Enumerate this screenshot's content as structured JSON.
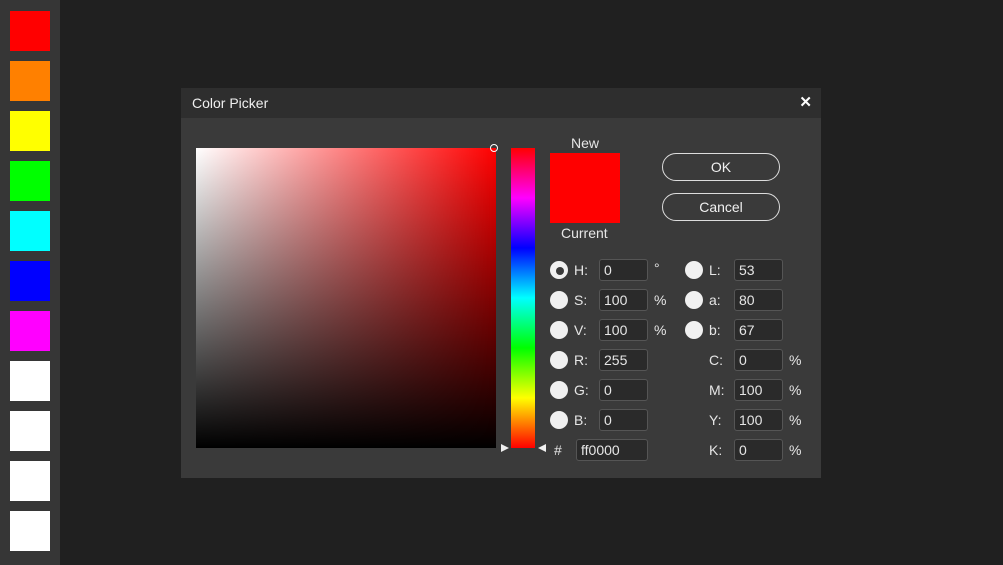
{
  "swatches": [
    {
      "name": "red",
      "color": "#ff0000"
    },
    {
      "name": "orange",
      "color": "#ff8000"
    },
    {
      "name": "yellow",
      "color": "#ffff00"
    },
    {
      "name": "green",
      "color": "#00ff00"
    },
    {
      "name": "cyan",
      "color": "#00ffff"
    },
    {
      "name": "blue",
      "color": "#0000ff"
    },
    {
      "name": "magenta",
      "color": "#ff00ff"
    },
    {
      "name": "white",
      "color": "#ffffff"
    },
    {
      "name": "white",
      "color": "#ffffff"
    },
    {
      "name": "white",
      "color": "#ffffff"
    },
    {
      "name": "white",
      "color": "#ffffff"
    }
  ],
  "dialog": {
    "title": "Color Picker",
    "close_icon": "close-icon",
    "preview": {
      "new_label": "New",
      "current_label": "Current",
      "new_color": "#ff0000",
      "current_color": "#ff0000"
    },
    "buttons": {
      "ok": "OK",
      "cancel": "Cancel"
    },
    "selected_hue_color": "#ff0000",
    "fields": {
      "H": {
        "label": "H:",
        "value": "0",
        "unit": "°"
      },
      "S": {
        "label": "S:",
        "value": "100",
        "unit": "%"
      },
      "V": {
        "label": "V:",
        "value": "100",
        "unit": "%"
      },
      "R": {
        "label": "R:",
        "value": "255",
        "unit": ""
      },
      "G": {
        "label": "G:",
        "value": "0",
        "unit": ""
      },
      "B": {
        "label": "B:",
        "value": "0",
        "unit": ""
      },
      "L": {
        "label": "L:",
        "value": "53",
        "unit": ""
      },
      "a": {
        "label": "a:",
        "value": "80",
        "unit": ""
      },
      "b": {
        "label": "b:",
        "value": "67",
        "unit": ""
      },
      "C": {
        "label": "C:",
        "value": "0",
        "unit": "%"
      },
      "M": {
        "label": "M:",
        "value": "100",
        "unit": "%"
      },
      "Y": {
        "label": "Y:",
        "value": "100",
        "unit": "%"
      },
      "K": {
        "label": "K:",
        "value": "0",
        "unit": "%"
      }
    },
    "hex": {
      "label": "#",
      "value": "ff0000"
    }
  }
}
